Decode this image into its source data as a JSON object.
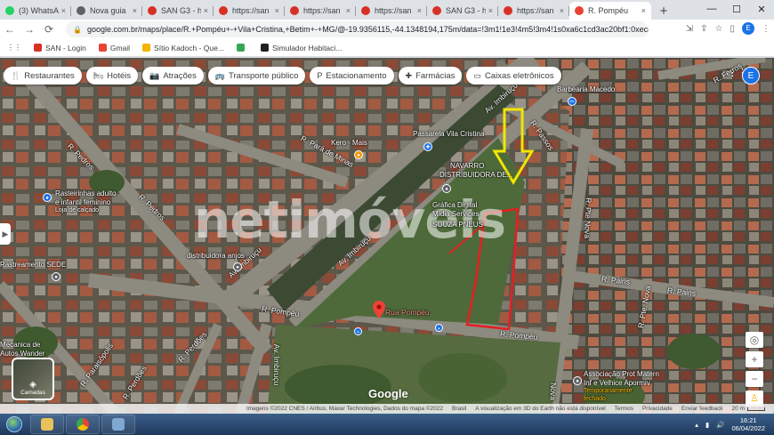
{
  "browser": {
    "tabs": [
      {
        "label": "(3) WhatsApp",
        "icon": "whatsapp-icon",
        "color": "#25d366"
      },
      {
        "label": "Nova guia",
        "icon": "chrome-icon",
        "color": "#5f6368"
      },
      {
        "label": "SAN G3 - h",
        "icon": "san-icon",
        "color": "#d93025"
      },
      {
        "label": "https://san",
        "icon": "page-icon",
        "color": "#d93025"
      },
      {
        "label": "https://san",
        "icon": "page-icon",
        "color": "#d93025"
      },
      {
        "label": "https://san",
        "icon": "page-icon",
        "color": "#d93025"
      },
      {
        "label": "SAN G3 - h",
        "icon": "san-icon",
        "color": "#d93025"
      },
      {
        "label": "https://san",
        "icon": "page-icon",
        "color": "#d93025"
      },
      {
        "label": "R. Pompéu",
        "icon": "maps-pin-icon",
        "color": "#ea4335",
        "active": true
      }
    ],
    "new_tab": "+",
    "url": "google.com.br/maps/place/R.+Pompéu+-+Vila+Cristina,+Betim+-+MG/@-19.9356115,-44.1348194,175m/data=!3m1!1e3!4m5!3m4!1s0xa6c1cd3ac20bf1:0xec8bf...",
    "bookmarks": [
      {
        "label": "SAN - Login",
        "color": "#d93025"
      },
      {
        "label": "Gmail",
        "color": "#ea4335"
      },
      {
        "label": "Sítio Kadoch - Que...",
        "color": "#f4b400"
      },
      {
        "label": "",
        "color": "#34a853"
      },
      {
        "label": "Simulador Habitaci...",
        "color": "#202124"
      }
    ],
    "profile_initial": "E"
  },
  "map": {
    "chips": [
      {
        "label": "Restaurantes",
        "icon": "fork-knife-icon",
        "glyph": "🍴"
      },
      {
        "label": "Hotéis",
        "icon": "bed-icon",
        "glyph": "🛏"
      },
      {
        "label": "Atrações",
        "icon": "camera-icon",
        "glyph": "📷"
      },
      {
        "label": "Transporte público",
        "icon": "bus-icon",
        "glyph": "🚌"
      },
      {
        "label": "Estacionamento",
        "icon": "parking-icon",
        "glyph": "P"
      },
      {
        "label": "Farmácias",
        "icon": "pharmacy-icon",
        "glyph": "✚"
      },
      {
        "label": "Caixas eletrônicos",
        "icon": "atm-icon",
        "glyph": "▭"
      }
    ],
    "avatar_initial": "E",
    "watermark": "netimóveis",
    "pin_label": "Rua Pompéu",
    "google_logo": "Google",
    "layers_label": "Camadas",
    "labels": {
      "rua_pompeu_1": "R. Pompéu",
      "rua_pompeu_2": "R. Pompéu",
      "av_imbirucu_1": "Av. Imbiruçu",
      "av_imbirucu_2": "Av. Imbiruçu",
      "av_imbirucu_3": "Av. Imbiruçu",
      "av_imbirucu_top": "Av. Imbiruçu",
      "r_passos": "R. Passos",
      "r_pedros_1": "R. Pedros",
      "r_pedros_2": "R. Pedros",
      "r_perdoes_1": "R. Perdões",
      "r_perdoes_2": "R. Perdões",
      "r_para_de_minas": "R. Pará de Minas",
      "r_pains_1": "R. Pains",
      "r_pains_2": "R. Pains",
      "r_pte_nova_1": "R. Pte Nova",
      "r_pte_nova_2": "R. Pte. Nova",
      "r_nova": "Nova",
      "r_paraisopolis": "R. Paraisópolis",
      "r_ferros": "R. Ferros",
      "passarela": "Passarela Vila Cristina",
      "kero_mais": "Kero - Mais",
      "navarro": "NAVARRO",
      "navarro_2": "DISTRIBUIDORA DE...",
      "grafica": "Gráfica Digital",
      "grafica_2": "Mídia Services",
      "souza_pneus": "SOUZA PNEUS",
      "rasteirinhas": "Rasteirinhas adulto",
      "rasteirinhas_2": "e infantil feminino",
      "rasteirinhas_3": "Loja de calçado",
      "distribuidora": "distribuidora anjos",
      "rastreamento": "Rastreamento SEDE",
      "barbearia": "Barbearia Macedo",
      "mecanica": "Mecanica de",
      "mecanica_2": "Autos Wander",
      "associacao": "Associação Prot Matern",
      "associacao_2": "Inf e Velhice Apormiv",
      "associacao_3": "Temporariamente",
      "associacao_4": "fechado"
    },
    "attribution": "Imagens ©2022 CNES / Airbus, Maxar Technologies, Dados do mapa ©2022",
    "attrib_links": [
      "Brasil",
      "A visualização em 3D do Earth não está disponível",
      "Termos",
      "Privacidade",
      "Enviar feedback"
    ],
    "scale": "20 m"
  },
  "taskbar": {
    "time": "16:21",
    "date": "06/04/2022"
  }
}
